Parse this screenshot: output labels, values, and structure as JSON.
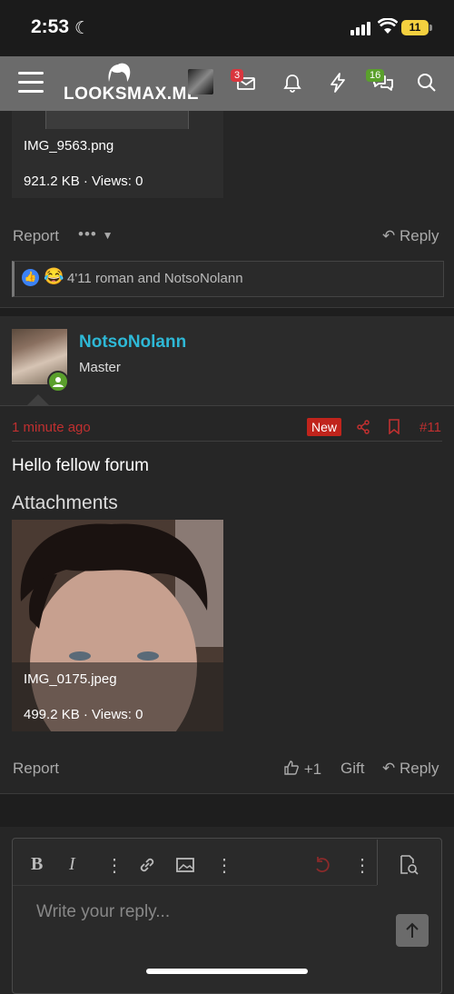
{
  "status": {
    "time": "2:53",
    "battery": "11"
  },
  "nav": {
    "logo": "LOOKSMAX.ME",
    "conversations_badge": "3",
    "alerts_badge": "16"
  },
  "previous_post": {
    "attachment_name": "IMG_9563.png",
    "attachment_meta": "921.2 KB · Views: 0",
    "report": "Report",
    "more": "•••",
    "reply": "Reply",
    "reactions_text": "4'11 roman and NotsoNolann"
  },
  "post": {
    "username": "NotsoNolann",
    "user_title": "Master",
    "time_ago": "1 minute ago",
    "new_label": "New",
    "post_number": "#11",
    "body": "Hello fellow forum",
    "attachments_heading": "Attachments",
    "attachment_name": "IMG_0175.jpeg",
    "attachment_meta": "499.2 KB · Views: 0",
    "report": "Report",
    "like": "+1",
    "gift": "Gift",
    "reply": "Reply"
  },
  "editor": {
    "placeholder": "Write your reply...",
    "bold": "B",
    "italic": "I"
  },
  "colors": {
    "username": "#2eb8d6",
    "new_badge": "#c0241c",
    "meta_red": "#c03030",
    "online": "#5aa02c"
  }
}
